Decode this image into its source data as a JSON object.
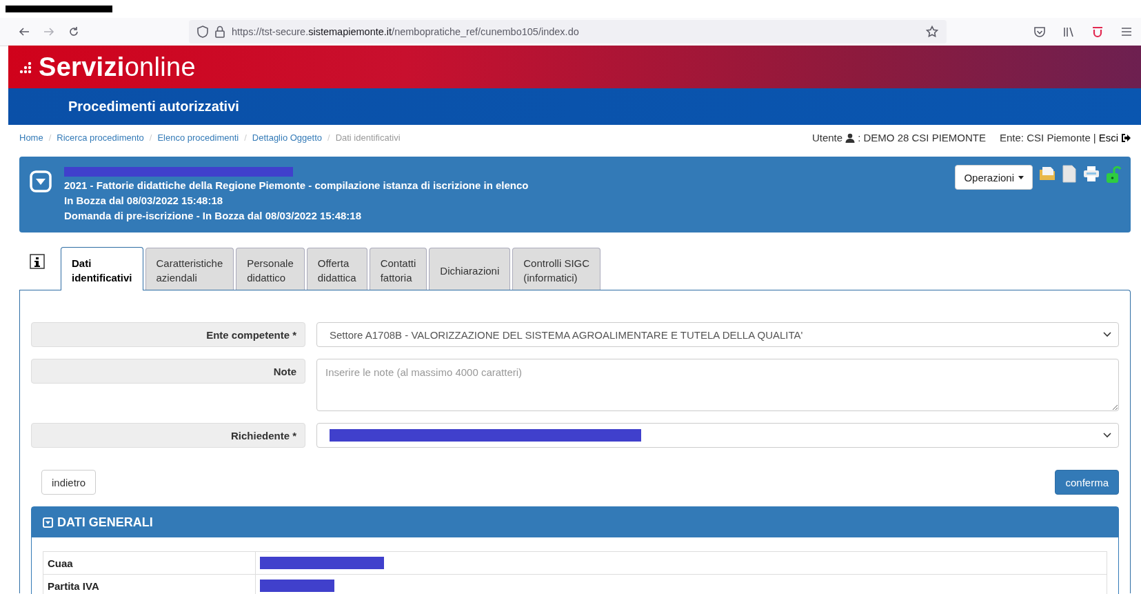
{
  "browser": {
    "url_prefix": "https://tst-secure.",
    "url_domain": "sistemapiemonte.it",
    "url_path": "/nembopratiche_ref/cunembo105/index.do"
  },
  "brand": {
    "bold": "Servizi",
    "light": "online"
  },
  "section_title": "Procedimenti autorizzativi",
  "breadcrumb": [
    {
      "label": "Home",
      "current": false
    },
    {
      "label": "Ricerca procedimento",
      "current": false
    },
    {
      "label": "Elenco procedimenti",
      "current": false
    },
    {
      "label": "Dettaglio Oggetto",
      "current": false
    },
    {
      "label": "Dati identificativi",
      "current": true
    }
  ],
  "breadcrumb_separator": "/",
  "user": {
    "label": "Utente",
    "name": ": DEMO 28 CSI PIEMONTE",
    "ente": "Ente: CSI Piemonte",
    "separator": "|",
    "logout": "Esci"
  },
  "object": {
    "title_redacted": true,
    "lines": [
      "2021 - Fattorie didattiche della Regione Piemonte - compilazione istanza di iscrizione in elenco",
      "In Bozza dal 08/03/2022 15:48:18",
      "Domanda di pre-iscrizione - In Bozza dal 08/03/2022 15:48:18"
    ],
    "operations": "Operazioni"
  },
  "tabs": [
    {
      "label": "Dati identificativi",
      "selected": true
    },
    {
      "label": "Caratteristiche aziendali",
      "selected": false
    },
    {
      "label": "Personale didattico",
      "selected": false
    },
    {
      "label": "Offerta didattica",
      "selected": false
    },
    {
      "label": "Contatti fattoria",
      "selected": false
    },
    {
      "label": "Dichiarazioni",
      "selected": false
    },
    {
      "label": "Controlli SIGC (informatici)",
      "selected": false
    }
  ],
  "form": {
    "fields": [
      {
        "label": "Ente competente *",
        "kind": "select",
        "value": "Settore A1708B - VALORIZZAZIONE DEL SISTEMA AGROALIMENTARE E TUTELA DELLA QUALITA'"
      },
      {
        "label": "Note",
        "kind": "textarea",
        "placeholder": "Inserire le note (al massimo 4000 caratteri)"
      },
      {
        "label": "Richiedente *",
        "kind": "select",
        "redacted": true
      }
    ],
    "back": "indietro",
    "confirm": "conferma"
  },
  "general": {
    "title": "DATI GENERALI",
    "rows": [
      {
        "label": "Cuaa",
        "redacted": true
      },
      {
        "label": "Partita IVA",
        "redacted": true
      }
    ]
  }
}
